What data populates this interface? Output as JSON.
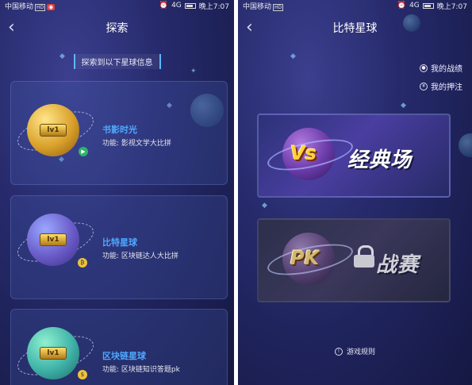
{
  "status_bar": {
    "left": {
      "carrier": "中国移动",
      "badge": "HD"
    },
    "right": {
      "time": "晚上7:07",
      "network": "4G"
    }
  },
  "explore_screen": {
    "title": "探索",
    "subtitle": "探索到以下星球信息",
    "planets": [
      {
        "name": "书影时光",
        "description": "功能: 影视文学大比拼",
        "level": "lv1",
        "planet_color": "#d9a02a",
        "accent_color": "#4ea8ff"
      },
      {
        "name": "比特星球",
        "description": "功能: 区块链达人大比拼",
        "level": "lv1",
        "planet_color": "#6a5bc9",
        "accent_color": "#4ea8ff"
      },
      {
        "name": "区块链星球",
        "description": "功能: 区块链知识答题pk",
        "level": "lv1",
        "planet_color": "#3fb2a8",
        "accent_color": "#4ea8ff"
      }
    ]
  },
  "planet_screen": {
    "title": "比特星球",
    "links": {
      "record": "我的战绩",
      "bets": "我的押注"
    },
    "modes": [
      {
        "logo": "Vs",
        "label": "经典场",
        "locked": false
      },
      {
        "logo": "PK",
        "label": "战赛",
        "locked": true
      }
    ],
    "rules": "游戏规则"
  },
  "icons": {
    "back": "back-arrow-icon",
    "alarm": "alarm-icon",
    "battery": "battery-icon",
    "person": "person-icon",
    "bet": "bet-icon",
    "info": "info-icon",
    "lock": "lock-icon"
  }
}
